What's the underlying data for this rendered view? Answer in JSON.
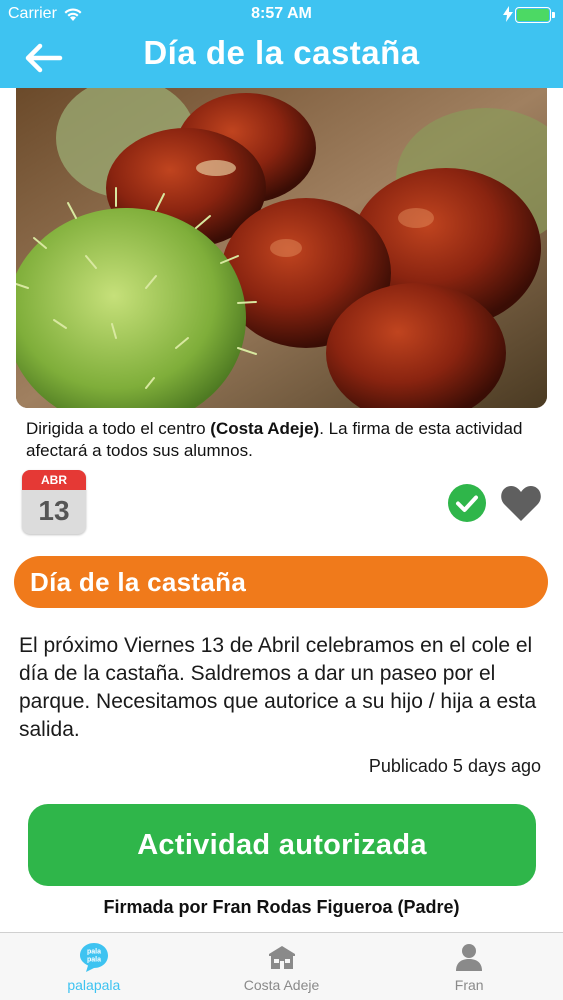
{
  "status_bar": {
    "carrier": "Carrier",
    "time": "8:57 AM",
    "battery_color": "#4CD964"
  },
  "header": {
    "title": "Día de la castaña",
    "back_icon": "arrow-left-icon",
    "background": "#3EC3F1"
  },
  "hero": {
    "icon": "chestnut-photo"
  },
  "audience": {
    "prefix": "Dirigida a todo el centro ",
    "school": "(Costa Adeje)",
    "suffix": ". La firma de esta actividad afectará a todos sus alumnos."
  },
  "calendar": {
    "month": "ABR",
    "day": "13"
  },
  "actions": {
    "check_icon": "check-circle-icon",
    "heart_icon": "heart-icon",
    "check_color": "#2FB64A"
  },
  "activity": {
    "title": "Día de la castaña",
    "title_color": "#F07A1B",
    "description": "El próximo Viernes 13 de Abril celebramos en el cole el día de la castaña. Saldremos a dar un paseo por el parque. Necesitamos que autorice a su hijo / hija a esta salida.",
    "published": "Publicado 5 days ago"
  },
  "authorization": {
    "button_label": "Actividad autorizada",
    "button_color": "#2FB64A",
    "signed_by": "Firmada por Fran Rodas Figueroa (Padre)"
  },
  "tab_bar": {
    "tabs": [
      {
        "label": "palapala",
        "icon": "palapala-logo-icon",
        "active": true
      },
      {
        "label": "Costa Adeje",
        "icon": "school-icon",
        "active": false
      },
      {
        "label": "Fran",
        "icon": "user-icon",
        "active": false
      }
    ],
    "logo_text": "pala pala"
  }
}
